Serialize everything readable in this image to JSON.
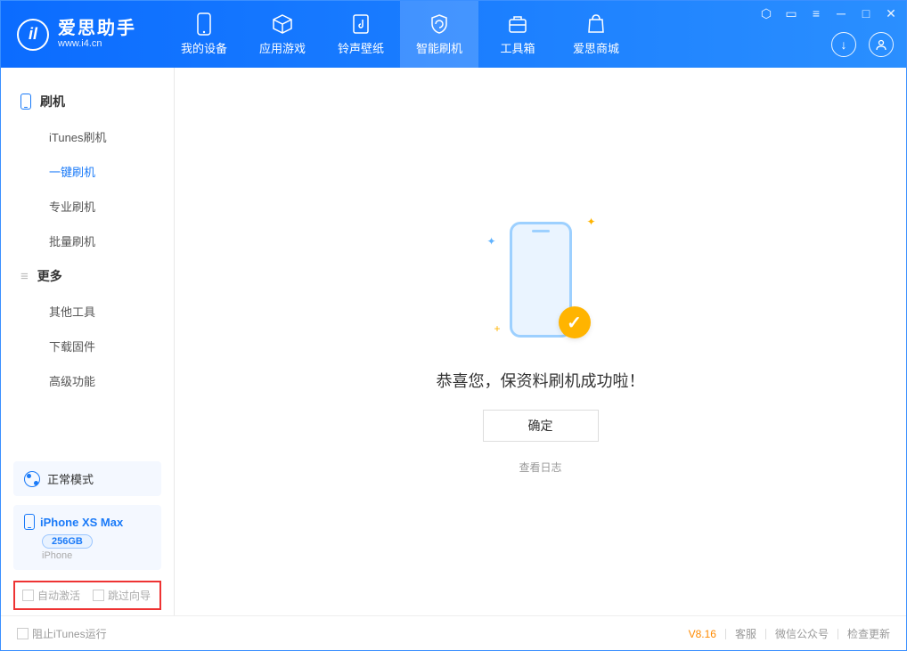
{
  "app": {
    "title": "爱思助手",
    "subtitle": "www.i4.cn"
  },
  "tabs": {
    "device": "我的设备",
    "apps": "应用游戏",
    "ringtones": "铃声壁纸",
    "flash": "智能刷机",
    "toolbox": "工具箱",
    "store": "爱思商城"
  },
  "sidebar": {
    "group_flash": "刷机",
    "items_flash": {
      "itunes": "iTunes刷机",
      "oneclick": "一键刷机",
      "pro": "专业刷机",
      "batch": "批量刷机"
    },
    "group_more": "更多",
    "items_more": {
      "other": "其他工具",
      "firmware": "下载固件",
      "advanced": "高级功能"
    }
  },
  "mode": {
    "label": "正常模式"
  },
  "device": {
    "name": "iPhone XS Max",
    "capacity": "256GB",
    "type": "iPhone"
  },
  "checkboxes": {
    "auto_activate": "自动激活",
    "skip_guide": "跳过向导"
  },
  "main": {
    "success_text": "恭喜您，保资料刷机成功啦！",
    "ok_button": "确定",
    "view_log": "查看日志"
  },
  "footer": {
    "block_itunes": "阻止iTunes运行",
    "version": "V8.16",
    "support": "客服",
    "wechat": "微信公众号",
    "update": "检查更新"
  }
}
